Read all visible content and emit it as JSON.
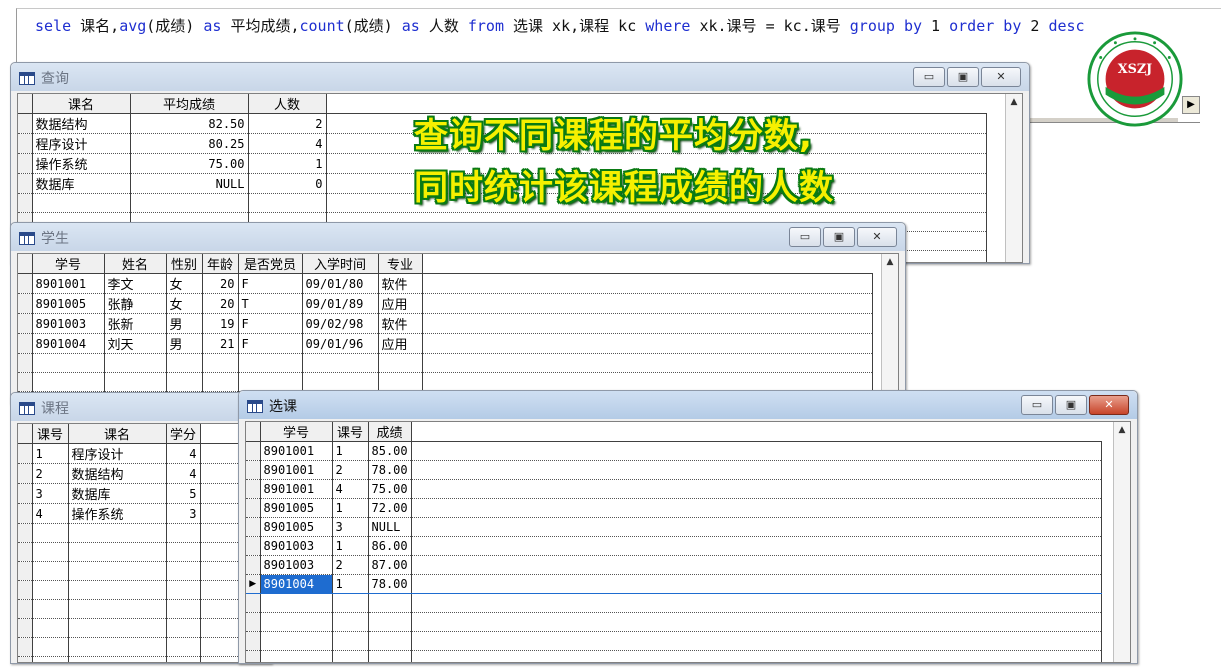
{
  "command": {
    "tokens": [
      {
        "t": "sele",
        "k": true
      },
      {
        "t": " 课名,",
        "k": false
      },
      {
        "t": "avg",
        "k": true
      },
      {
        "t": "(成绩) ",
        "k": false
      },
      {
        "t": "as",
        "k": true
      },
      {
        "t": " 平均成绩,",
        "k": false
      },
      {
        "t": "count",
        "k": true
      },
      {
        "t": "(成绩) ",
        "k": false
      },
      {
        "t": "as",
        "k": true
      },
      {
        "t": " 人数 ",
        "k": false
      },
      {
        "t": "from",
        "k": true
      },
      {
        "t": " 选课 xk,课程 kc ",
        "k": false
      },
      {
        "t": "where",
        "k": true
      },
      {
        "t": " xk.课号 = kc.课号  ",
        "k": false
      },
      {
        "t": "group by",
        "k": true
      },
      {
        "t": " 1 ",
        "k": false
      },
      {
        "t": "order by",
        "k": true
      },
      {
        "t": " 2 ",
        "k": false
      },
      {
        "t": "desc",
        "k": true
      }
    ]
  },
  "logo": {
    "text": "XSZJ",
    "colors": {
      "green": "#1a9a3a",
      "red": "#c8232c"
    }
  },
  "banner": {
    "line1": "查询不同课程的平均分数,",
    "line2": "同时统计该课程成绩的人数"
  },
  "query_window": {
    "title": "查询",
    "columns": [
      "课名",
      "平均成绩",
      "人数"
    ],
    "rows": [
      [
        "数据结构",
        "82.50",
        "2"
      ],
      [
        "程序设计",
        "80.25",
        "4"
      ],
      [
        "操作系统",
        "75.00",
        "1"
      ],
      [
        "数据库",
        "NULL",
        "0"
      ]
    ]
  },
  "student_window": {
    "title": "学生",
    "columns": [
      "学号",
      "姓名",
      "性别",
      "年龄",
      "是否党员",
      "入学时间",
      "专业"
    ],
    "rows": [
      [
        "8901001",
        "李文",
        "女",
        "20",
        "F",
        "09/01/80",
        "软件"
      ],
      [
        "8901005",
        "张静",
        "女",
        "20",
        "T",
        "09/01/89",
        "应用"
      ],
      [
        "8901003",
        "张新",
        "男",
        "19",
        "F",
        "09/02/98",
        "软件"
      ],
      [
        "8901004",
        "刘天",
        "男",
        "21",
        "F",
        "09/01/96",
        "应用"
      ]
    ]
  },
  "course_window": {
    "title": "课程",
    "columns": [
      "课号",
      "课名",
      "学分"
    ],
    "rows": [
      [
        "1",
        "程序设计",
        "4"
      ],
      [
        "2",
        "数据结构",
        "4"
      ],
      [
        "3",
        "数据库",
        "5"
      ],
      [
        "4",
        "操作系统",
        "3"
      ]
    ]
  },
  "select_window": {
    "title": "选课",
    "columns": [
      "学号",
      "课号",
      "成绩"
    ],
    "rows": [
      [
        "8901001",
        "1",
        "85.00"
      ],
      [
        "8901001",
        "2",
        "78.00"
      ],
      [
        "8901001",
        "4",
        "75.00"
      ],
      [
        "8901005",
        "1",
        "72.00"
      ],
      [
        "8901005",
        "3",
        "NULL"
      ],
      [
        "8901003",
        "1",
        "86.00"
      ],
      [
        "8901003",
        "2",
        "87.00"
      ],
      [
        "8901004",
        "1",
        "78.00"
      ]
    ],
    "current_row": 7
  },
  "window_buttons": {
    "minimize": "▭",
    "maximize": "▣",
    "close": "✕"
  },
  "scroll_arrows": {
    "up": "▲",
    "right": "▶",
    "row_pointer": "▶"
  }
}
